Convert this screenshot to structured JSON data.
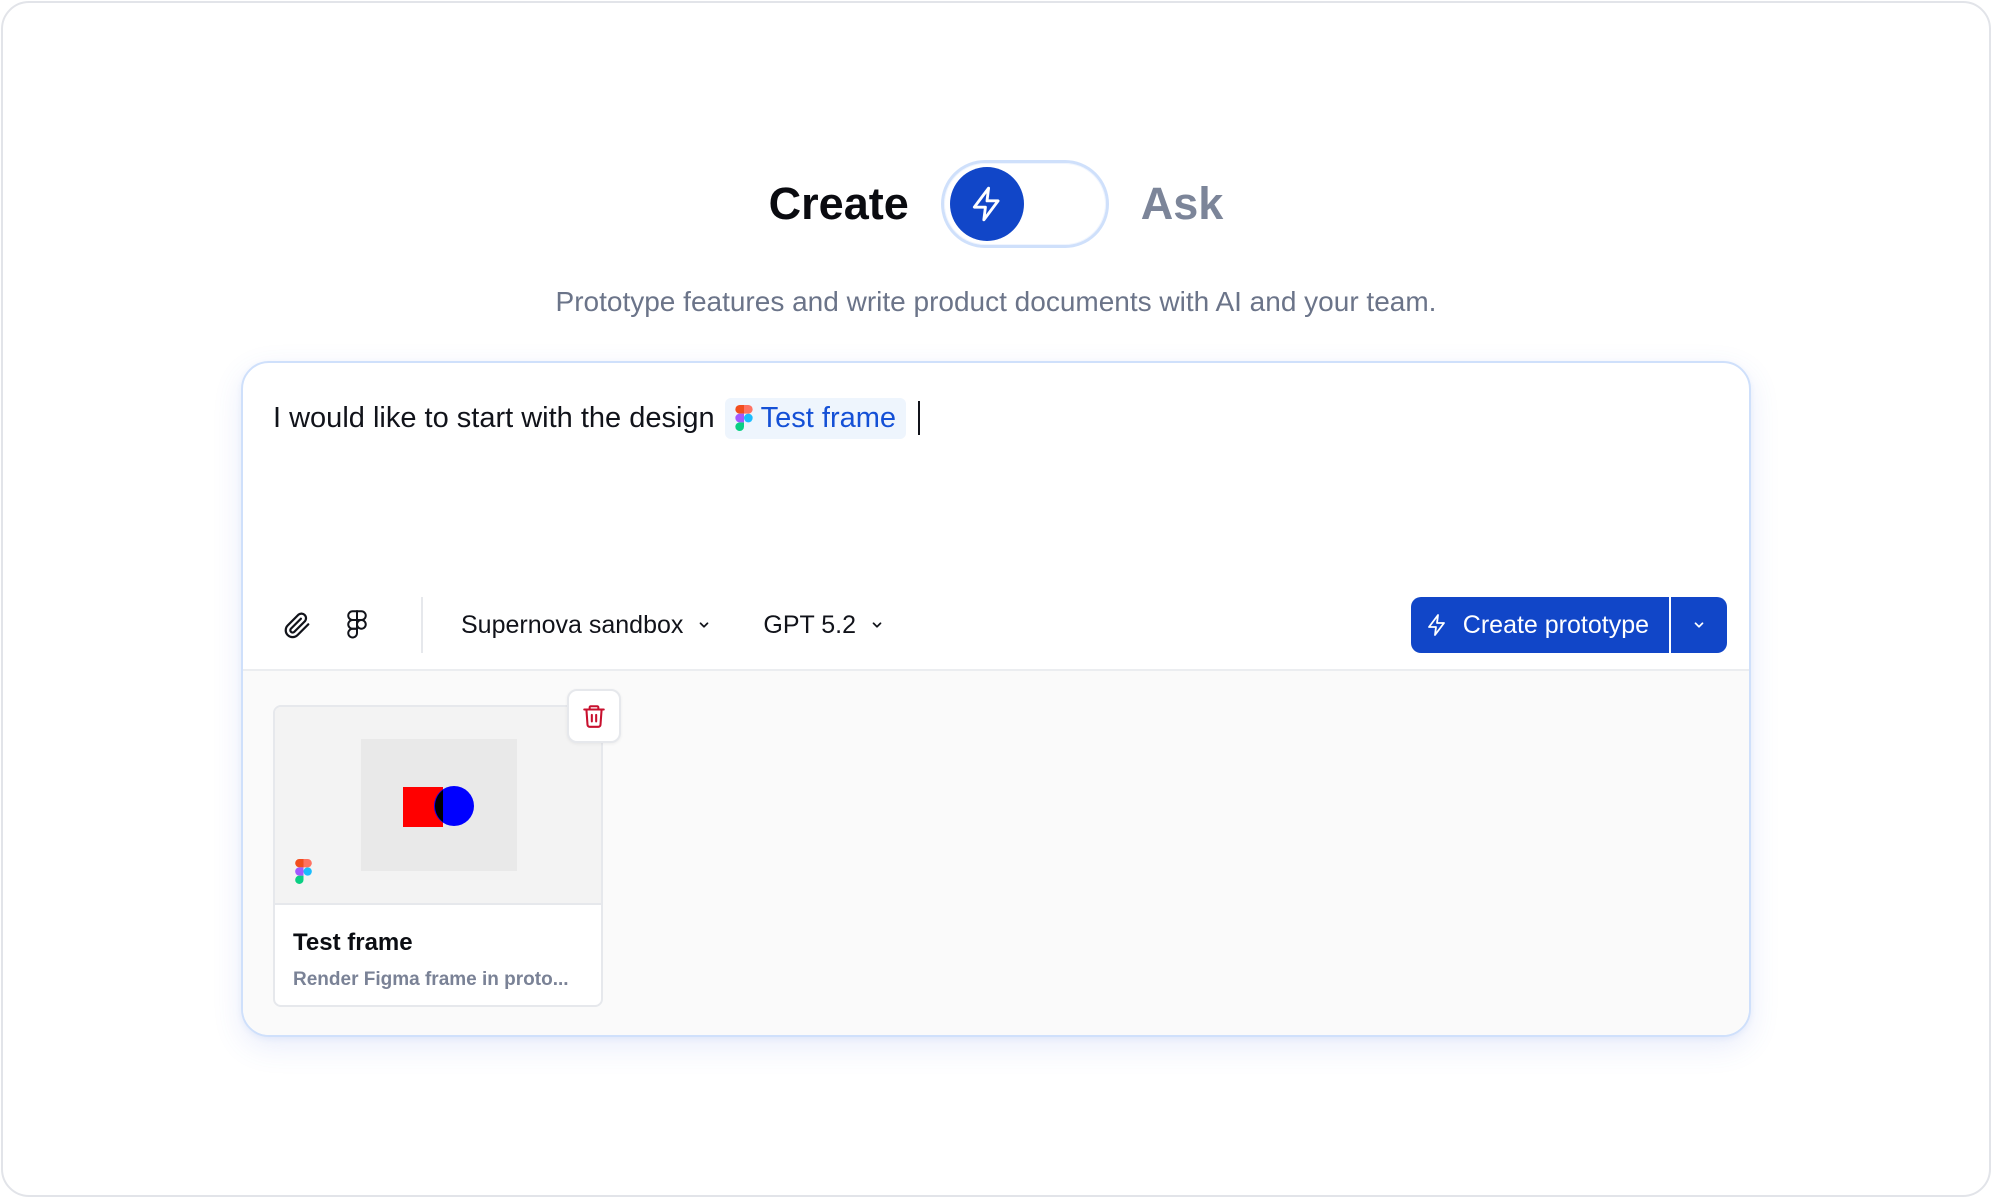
{
  "mode_switch": {
    "create_label": "Create",
    "ask_label": "Ask",
    "active": "create"
  },
  "subtitle": "Prototype features and write product documents with AI and your team.",
  "composer": {
    "prompt_text": "I would like to start with the design",
    "mention_label": "Test frame",
    "toolbar": {
      "attach_icon": "paperclip-icon",
      "figma_icon": "figma-icon",
      "workspace_select": "Supernova sandbox",
      "model_select": "GPT 5.2",
      "primary_button": "Create prototype"
    },
    "attachments": [
      {
        "title": "Test frame",
        "description": "Render Figma frame in proto...",
        "source_icon": "figma-icon"
      }
    ]
  },
  "colors": {
    "accent": "#1146c8",
    "mention_text": "#1450d6",
    "muted": "#7c8599",
    "delete": "#c8102e"
  }
}
